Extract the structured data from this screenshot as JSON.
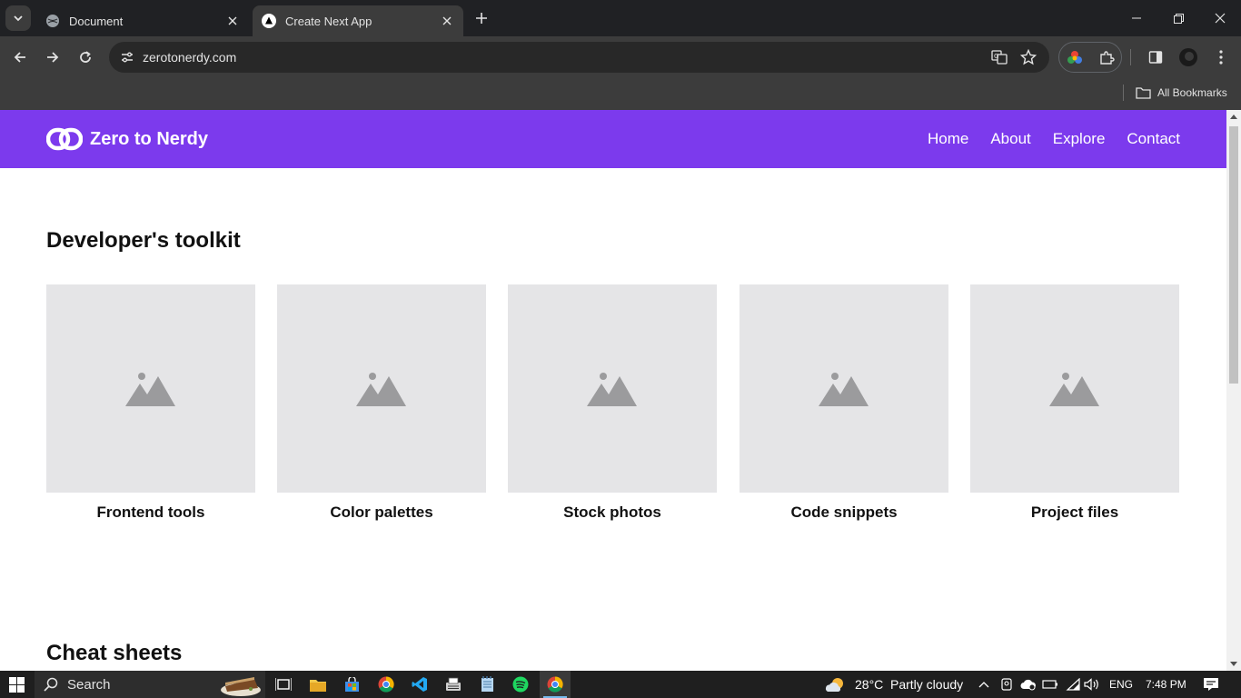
{
  "browser": {
    "tabs": [
      {
        "title": "Document",
        "favicon": "globe-icon",
        "active": false
      },
      {
        "title": "Create Next App",
        "favicon": "nextjs-icon",
        "active": true
      }
    ],
    "url": "zerotonerdy.com",
    "bookmarks": {
      "all_label": "All Bookmarks"
    }
  },
  "site": {
    "brand": "Zero to Nerdy",
    "nav": [
      "Home",
      "About",
      "Explore",
      "Contact"
    ],
    "accent": "#7c3aed",
    "sections": [
      {
        "title": "Developer's toolkit",
        "cards": [
          {
            "label": "Frontend tools",
            "image": "image-placeholder-icon"
          },
          {
            "label": "Color palettes",
            "image": "image-placeholder-icon"
          },
          {
            "label": "Stock photos",
            "image": "image-placeholder-icon"
          },
          {
            "label": "Code snippets",
            "image": "image-placeholder-icon"
          },
          {
            "label": "Project files",
            "image": "image-placeholder-icon"
          }
        ]
      },
      {
        "title": "Cheat sheets",
        "cards": []
      }
    ]
  },
  "taskbar": {
    "search_label": "Search",
    "weather": {
      "temp": "28°C",
      "condition": "Partly cloudy"
    },
    "language": "ENG",
    "time": "7:48 PM"
  }
}
